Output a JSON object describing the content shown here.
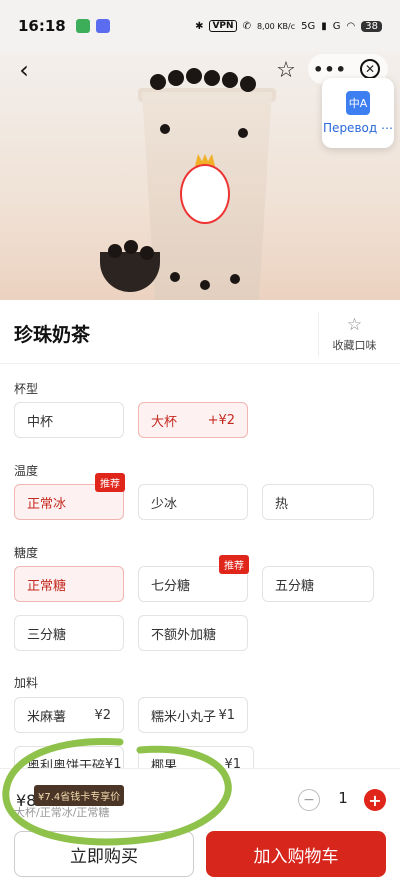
{
  "status_bar": {
    "time": "16:18",
    "vpn": "VPN",
    "net_speed": "8,00 KB/c",
    "signal_a": "5G",
    "signal_b": "G",
    "battery": "38"
  },
  "header": {
    "back_icon": "back-arrow-icon",
    "favorite_icon": "star-icon",
    "more_label": "•••",
    "close_icon": "close-icon"
  },
  "translate_popup": {
    "icon_text": "中A",
    "label": "Перевод ⋯"
  },
  "product": {
    "name": "珍珠奶茶",
    "fav_flavor_label": "收藏口味"
  },
  "sections": {
    "cup": {
      "title": "杯型",
      "options": [
        {
          "label": "中杯",
          "price": "",
          "selected": false
        },
        {
          "label": "大杯",
          "price": "+¥2",
          "selected": true
        }
      ]
    },
    "temperature": {
      "title": "温度",
      "options": [
        {
          "label": "正常冰",
          "selected": true,
          "badge": "推荐"
        },
        {
          "label": "少冰",
          "selected": false
        },
        {
          "label": "热",
          "selected": false
        }
      ]
    },
    "sugar": {
      "title": "糖度",
      "options": [
        {
          "label": "正常糖",
          "selected": true
        },
        {
          "label": "七分糖",
          "selected": false,
          "badge": "推荐"
        },
        {
          "label": "五分糖",
          "selected": false
        },
        {
          "label": "三分糖",
          "selected": false
        },
        {
          "label": "不额外加糖",
          "selected": false
        }
      ]
    },
    "toppings": {
      "title": "加料",
      "options": [
        {
          "label": "米麻薯",
          "price": "¥2"
        },
        {
          "label": "糯米小丸子",
          "price": "¥1"
        },
        {
          "label": "奥利奥饼干碎",
          "price": "¥1"
        },
        {
          "label": "椰果",
          "price": "¥1"
        }
      ]
    }
  },
  "bottom": {
    "price": "¥8",
    "promo": "¥7.4省钱卡专享价",
    "spec_summary": "大杯/正常冰/正常糖",
    "quantity": "1",
    "minus": "−",
    "plus": "+",
    "buy_now": "立即购买",
    "add_cart": "加入购物车"
  },
  "colors": {
    "accent": "#d7261c",
    "selected_bg": "#fdf2f1",
    "selected_text": "#c52a20",
    "annotation": "#8fc24a"
  }
}
